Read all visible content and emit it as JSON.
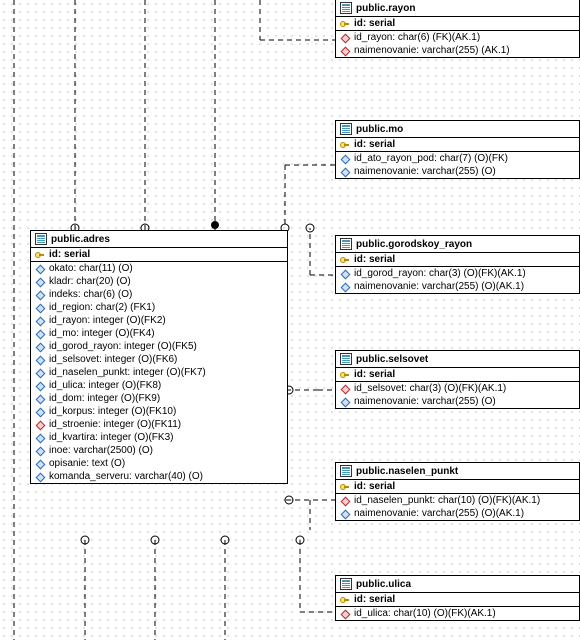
{
  "tables": {
    "adres": {
      "title": "public.adres",
      "pk": "id: serial",
      "cols": [
        "okato: char(11) (O)",
        "kladr: char(20) (O)",
        "indeks: char(6) (O)",
        "id_region: char(2) (FK1)",
        "id_rayon: integer (O)(FK2)",
        "id_mo: integer (O)(FK4)",
        "id_gorod_rayon: integer (O)(FK5)",
        "id_selsovet: integer (O)(FK6)",
        "id_naselen_punkt: integer (O)(FK7)",
        "id_ulica: integer (O)(FK8)",
        "id_dom: integer (O)(FK9)",
        "id_korpus: integer (O)(FK10)",
        "id_stroenie: integer (O)(FK11)",
        "id_kvartira: integer (O)(FK3)",
        "inoe: varchar(2500) (O)",
        "opisanie: text (O)",
        "komanda_serveru: varchar(40) (O)"
      ],
      "red_index": 12
    },
    "rayon": {
      "title": "public.rayon",
      "pk": "id: serial",
      "cols": [
        "id_rayon: char(6) (FK)(AK.1)",
        "naimenovanie: varchar(255) (AK.1)"
      ]
    },
    "mo": {
      "title": "public.mo",
      "pk": "id: serial",
      "cols": [
        "id_ato_rayon_pod: char(7) (O)(FK)",
        "naimenovanie: varchar(255) (O)"
      ]
    },
    "gorodskoy_rayon": {
      "title": "public.gorodskoy_rayon",
      "pk": "id: serial",
      "cols": [
        "id_gorod_rayon: char(3) (O)(FK)(AK.1)",
        "naimenovanie: varchar(255) (O)(AK.1)"
      ]
    },
    "selsovet": {
      "title": "public.selsovet",
      "pk": "id: serial",
      "cols": [
        "id_selsovet: char(3) (O)(FK)(AK.1)",
        "naimenovanie: varchar(255) (O)"
      ]
    },
    "naselen_punkt": {
      "title": "public.naselen_punkt",
      "pk": "id: serial",
      "cols": [
        "id_naselen_punkt: char(10) (O)(FK)(AK.1)",
        "naimenovanie: varchar(255) (O)(AK.1)"
      ]
    },
    "ulica": {
      "title": "public.ulica",
      "pk": "id: serial",
      "cols": [
        "id_ulica: char(10) (O)(FK)(AK.1)"
      ]
    }
  }
}
